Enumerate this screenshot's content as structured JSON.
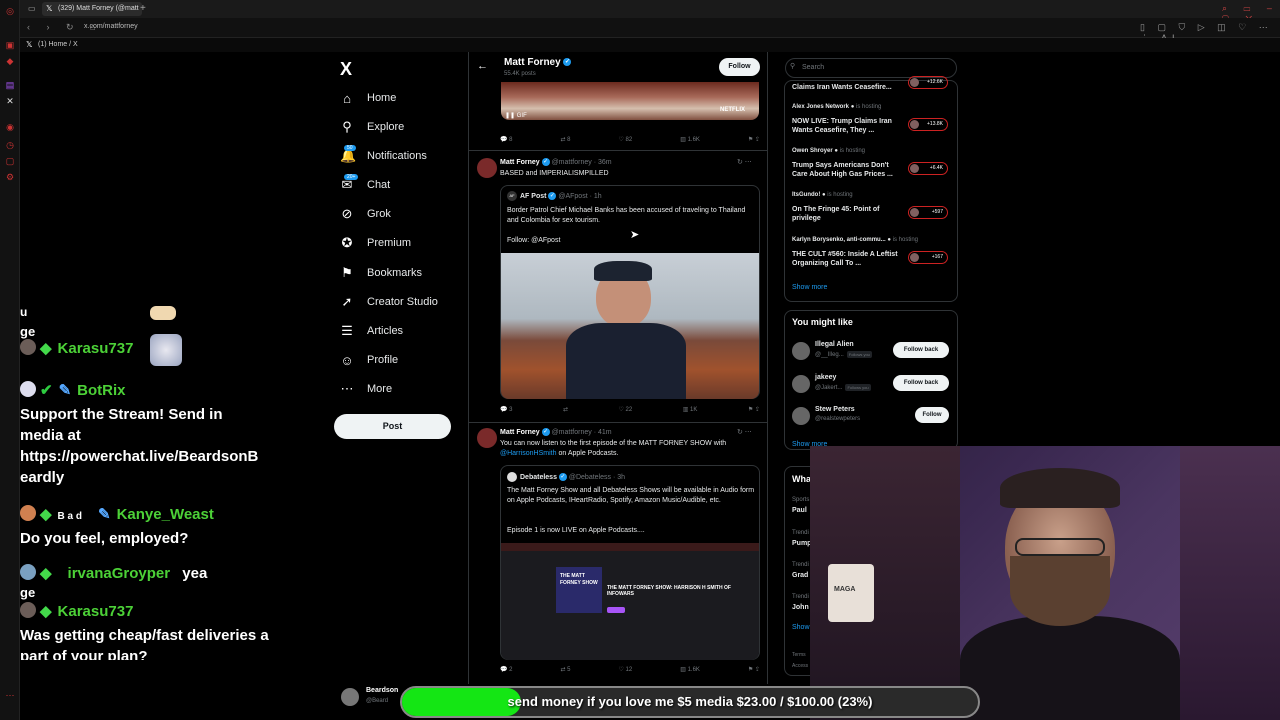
{
  "browser": {
    "tab_title": "(329) Matt Forney (@matt",
    "url": "x.com/mattforney",
    "bookmark": "(1) Home / X"
  },
  "nav": {
    "logo": "X",
    "items": [
      {
        "label": "Home",
        "icon": "home-icon",
        "glyph": "⌂"
      },
      {
        "label": "Explore",
        "icon": "search-icon",
        "glyph": "⚲"
      },
      {
        "label": "Notifications",
        "icon": "bell-icon",
        "glyph": "🔔",
        "badge": "50"
      },
      {
        "label": "Chat",
        "icon": "chat-icon",
        "glyph": "✉",
        "badge": "20+"
      },
      {
        "label": "Grok",
        "icon": "grok-icon",
        "glyph": "⊘"
      },
      {
        "label": "Premium",
        "icon": "premium-icon",
        "glyph": "✪"
      },
      {
        "label": "Bookmarks",
        "icon": "bookmark-icon",
        "glyph": "⚑"
      },
      {
        "label": "Creator Studio",
        "icon": "rocket-icon",
        "glyph": "➚"
      },
      {
        "label": "Articles",
        "icon": "articles-icon",
        "glyph": "☰"
      },
      {
        "label": "Profile",
        "icon": "profile-icon",
        "glyph": "☺"
      },
      {
        "label": "More",
        "icon": "more-icon",
        "glyph": "⋯"
      }
    ],
    "post_label": "Post"
  },
  "profile_header": {
    "name": "Matt Forney",
    "posts": "55.4K posts",
    "follow_label": "Follow"
  },
  "tweets": [
    {
      "gif_label": "GIF",
      "netflix": "NETFLIX",
      "actions": {
        "replies": "8",
        "reposts": "8",
        "likes": "82",
        "views": "1.6K"
      }
    },
    {
      "name": "Matt Forney",
      "handle_time": "@mattforney · 36m",
      "text": "BASED and IMPERIALISMPILLED",
      "quote": {
        "name": "AF Post",
        "handle_time": "@AFpost · 1h",
        "text": "Border Patrol Chief Michael Banks has been accused of traveling to Thailand and Colombia for sex tourism.",
        "follow": "Follow: @AFpost"
      },
      "actions": {
        "replies": "3",
        "reposts": "",
        "likes": "22",
        "views": "1K"
      }
    },
    {
      "name": "Matt Forney",
      "handle_time": "@mattforney · 41m",
      "text_1": "You can now listen to the first episode of the MATT FORNEY SHOW with",
      "link": "@HarrisonHSmith",
      "text_2": "on Apple Podcasts.",
      "quote": {
        "name": "Debateless",
        "handle_time": "@Debateless · 3h",
        "text": "The Matt Forney Show and all Debateless Shows will be available in Audio form on Apple Podcasts, IHeartRadio, Spotify, Amazon Music/Audible, etc.",
        "text_2": "Episode 1 is now LIVE on Apple Podcasts....",
        "podcast_title": "THE MATT FORNEY SHOW",
        "episode_title": "THE MATT FORNEY SHOW: HARRISON H SMITH OF INFOWARS"
      },
      "actions": {
        "replies": "2",
        "reposts": "5",
        "likes": "12",
        "views": "1.6K"
      }
    }
  ],
  "right": {
    "search_placeholder": "Search",
    "live": [
      {
        "user": "",
        "title": "Claims Iran Wants Ceasefire...",
        "count": "+12.6K"
      },
      {
        "user": "Alex Jones Network",
        "status": "is hosting",
        "title": "NOW LIVE: Trump Claims Iran Wants Ceasefire, They ...",
        "count": "+13.8K"
      },
      {
        "user": "Owen Shroyer",
        "status": "is hosting",
        "title": "Trump Says Americans Don't Care About High Gas Prices ...",
        "count": "+6.4K"
      },
      {
        "user": "ItsGundo!",
        "status": "is hosting",
        "title": "On The Fringe 45: Point of privilege",
        "count": "+597"
      },
      {
        "user": "Karlyn Borysenko, anti-commu...",
        "status": "is hosting",
        "title": "THE CULT #560: Inside A Leftist Organizing Call To ...",
        "count": "+167"
      }
    ],
    "show_more": "Show more",
    "might_like_title": "You might like",
    "suggestions": [
      {
        "name": "Illegal Alien",
        "handle": "@__Illeg...",
        "follows_you": "Follows you",
        "btn": "Follow back"
      },
      {
        "name": "jakeey",
        "handle": "@Jakert...",
        "follows_you": "Follows you",
        "btn": "Follow back"
      },
      {
        "name": "Stew Peters",
        "handle": "@realstewpeters",
        "follows_you": "",
        "btn": "Follow"
      }
    ],
    "show_more_2": "Show more",
    "whats_title": "Wha",
    "trends": [
      {
        "cat": "Sports",
        "name": "Paul"
      },
      {
        "cat": "Trendi",
        "name": "Pump"
      },
      {
        "cat": "Trendi",
        "name": "Grad"
      },
      {
        "cat": "Trendi",
        "name": "John"
      }
    ],
    "show_3": "Show",
    "terms": "Terms",
    "access": "Access"
  },
  "chat": {
    "lines": [
      {
        "frag": "u"
      },
      {
        "frag": "ge"
      },
      {
        "user": "Karasu737"
      },
      {
        "user": "BotRix"
      },
      {
        "msg": "Support the Stream! Send in media at https://powerchat.live/BeardsonB eardly"
      },
      {
        "user": "Kanye_Weast",
        "pre": "B a d"
      },
      {
        "msg": "Do you feel, employed?"
      },
      {
        "user": "irvanaGroyper",
        "post": "yea"
      },
      {
        "frag": "ge"
      },
      {
        "user": "Karasu737"
      },
      {
        "msg": "Was getting cheap/fast deliveries a part of your plan?"
      }
    ]
  },
  "webcam": {
    "mug_text": "MAGA"
  },
  "donation": {
    "text": "send money if you love me $5 media $23.00 / $100.00 (23%)",
    "progress": 0.23
  },
  "bottom_profile": {
    "name": "Beardson",
    "handle": "@Beard"
  }
}
